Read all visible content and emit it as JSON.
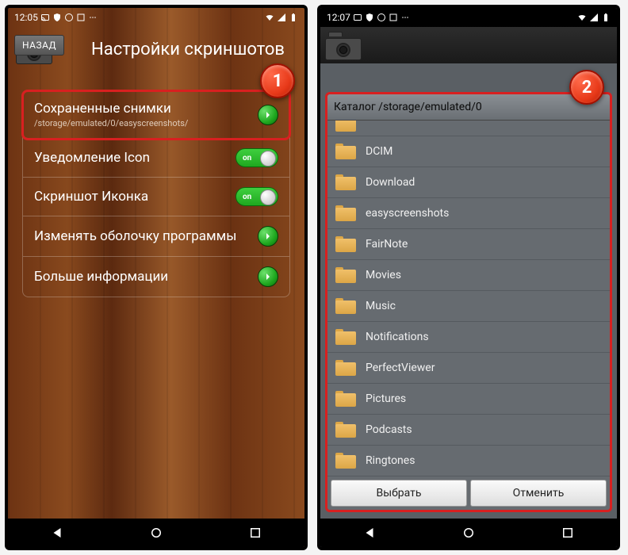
{
  "left": {
    "status_time": "12:05",
    "back_label": "НАЗАД",
    "title": "Настройки скриншотов",
    "badge": "1",
    "rows": {
      "r0": {
        "label": "Сохраненные снимки",
        "sub": "/storage/emulated/0/easyscreenshots/"
      },
      "r1": {
        "label": "Уведомление Icon",
        "toggle": "on"
      },
      "r2": {
        "label": "Скриншот Иконка",
        "toggle": "on"
      },
      "r3": {
        "label": "Изменять оболочку программы"
      },
      "r4": {
        "label": "Больше информации"
      }
    }
  },
  "right": {
    "status_time": "12:07",
    "badge": "2",
    "path_label": "Каталог /storage/emulated/0",
    "folders": {
      "f0": "DCIM",
      "f1": "Download",
      "f2": "easyscreenshots",
      "f3": "FairNote",
      "f4": "Movies",
      "f5": "Music",
      "f6": "Notifications",
      "f7": "PerfectViewer",
      "f8": "Pictures",
      "f9": "Podcasts",
      "f10": "Ringtones"
    },
    "select_label": "Выбрать",
    "cancel_label": "Отменить"
  }
}
